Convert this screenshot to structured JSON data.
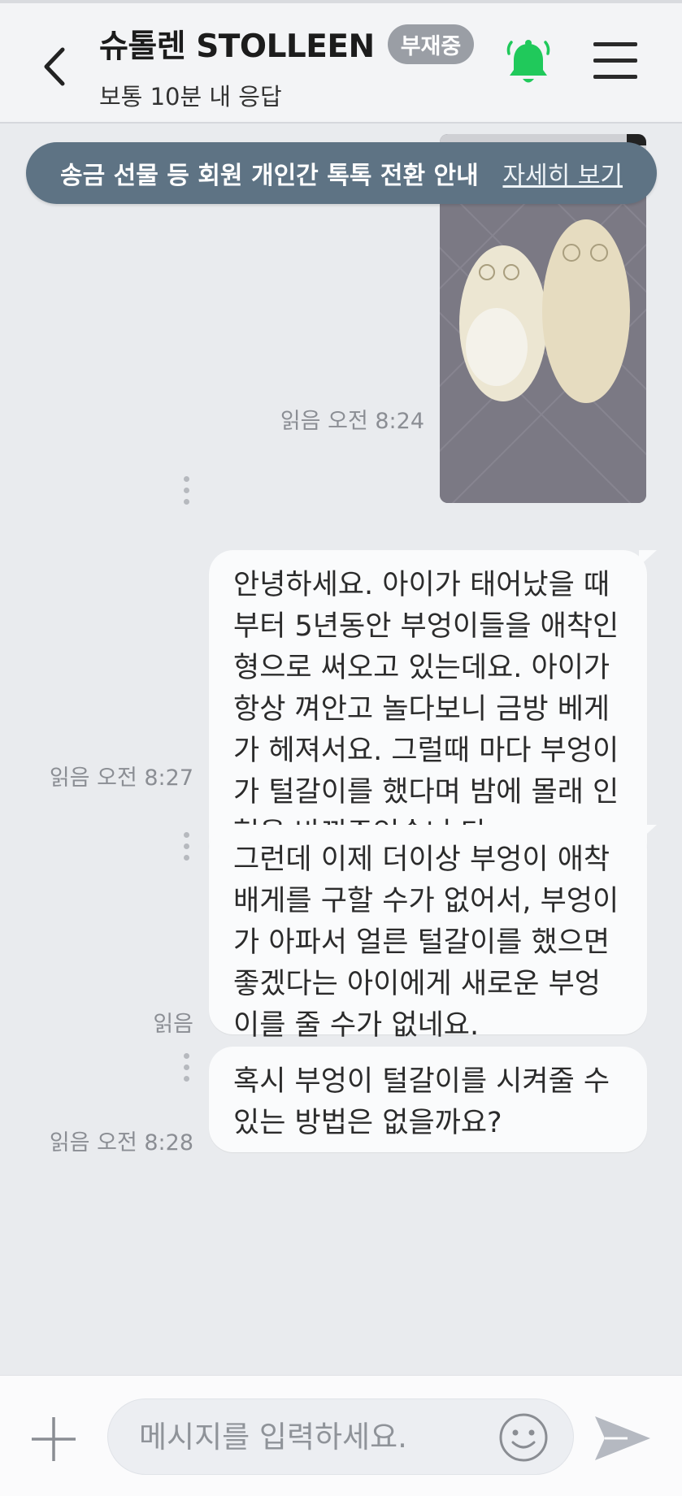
{
  "header": {
    "title": "슈톨렌 STOLLEEN",
    "status_badge": "부재중",
    "response_time": "보통 10분 내 응답",
    "icons": {
      "back": "chevron-left-icon",
      "bell": "bell-icon",
      "menu": "hamburger-menu-icon"
    },
    "bell_color": "#20c95b"
  },
  "notice": {
    "text": "송금 선물 등 회원 개인간 톡톡 전환 안내",
    "link": "자세히 보기"
  },
  "messages": [
    {
      "type": "image",
      "meta": "읽음 오전 8:24"
    },
    {
      "type": "text",
      "meta": "읽음 오전 8:27",
      "text": "안녕하세요. 아이가 태어났을 때부터 5년동안 부엉이들을 애착인형으로 써오고 있는데요. 아이가 항상 껴안고 놀다보니 금방 베게가 헤져서요. 그럴때 마다 부엉이가 털갈이를 했다며 밤에 몰래 인형을 바꿔주었습니 다."
    },
    {
      "type": "text",
      "meta": "읽음",
      "text": "그런데 이제 더이상 부엉이 애착배게를 구할 수가 없어서, 부엉이가 아파서 얼른 털갈이를 했으면 좋겠다는 아이에게 새로운 부엉이를 줄 수가 없네요."
    },
    {
      "type": "text",
      "meta": "읽음 오전 8:28",
      "text": "혹시 부엉이 털갈이를 시켜줄 수 있는 방법은 없을까요?"
    }
  ],
  "input": {
    "placeholder": "메시지를 입력하세요.",
    "icons": {
      "plus": "plus-icon",
      "emoji": "smiley-icon",
      "send": "send-icon"
    }
  }
}
